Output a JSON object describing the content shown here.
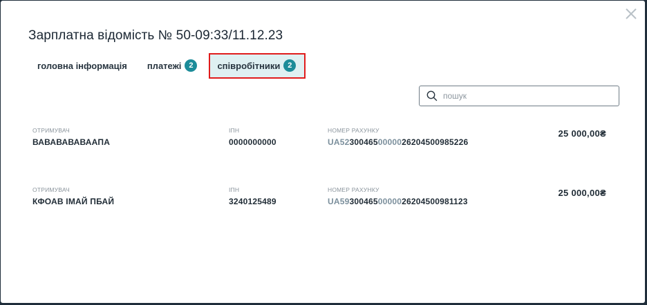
{
  "dialog": {
    "title": "Зарплатна відомість № 50-09:33/11.12.23"
  },
  "tabs": [
    {
      "label": "головна інформація"
    },
    {
      "label": "платежі",
      "badge": "2"
    },
    {
      "label": "співробітники",
      "badge": "2",
      "active": true
    }
  ],
  "search": {
    "placeholder": "пошук",
    "value": ""
  },
  "employees": [
    {
      "recipient_label": "ОТРИМУВАЧ",
      "recipient": "ВАВАВАВАВААПА",
      "ipn_label": "ІПН",
      "ipn": "0000000000",
      "account_label": "НОМЕР РАХУНКУ",
      "account_part1": "UA52",
      "account_part2": "300465",
      "account_part3": "00000",
      "account_part4": "26204500985226",
      "amount": "25 000,00₴"
    },
    {
      "recipient_label": "ОТРИМУВАЧ",
      "recipient": "КФОАВ ІМАЙ ПБАЙ",
      "ipn_label": "ІПН",
      "ipn": "3240125489",
      "account_label": "НОМЕР РАХУНКУ",
      "account_part1": "UA59",
      "account_part2": "300465",
      "account_part3": "00000",
      "account_part4": "26204500981123",
      "amount": "25 000,00₴"
    }
  ],
  "colors": {
    "accent": "#1c8c99",
    "highlight_border": "#e01b1b",
    "active_tab_bg": "#dff0f2",
    "text": "#1f2b35",
    "muted": "#8a949c"
  }
}
